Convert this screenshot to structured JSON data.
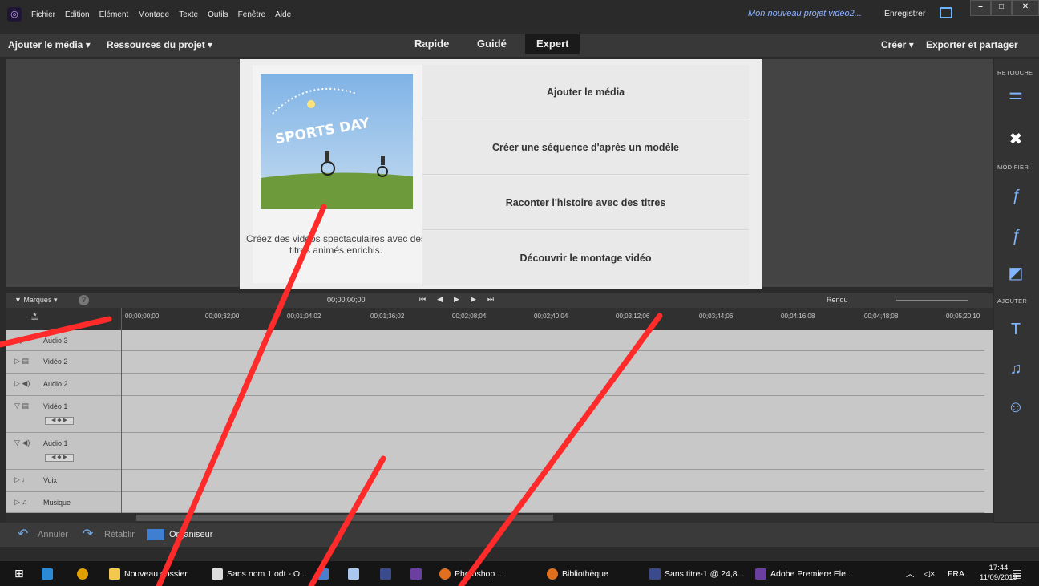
{
  "menu": [
    "Fichier",
    "Edition",
    "Elément",
    "Montage",
    "Texte",
    "Outils",
    "Fenêtre",
    "Aide"
  ],
  "titlebar": {
    "project": "Mon nouveau projet vidéo2...",
    "save": "Enregistrer"
  },
  "modebar": {
    "add_media": "Ajouter le média",
    "resources": "Ressources du projet",
    "tabs": [
      "Rapide",
      "Guidé",
      "Expert"
    ],
    "create": "Créer",
    "export": "Exporter et partager"
  },
  "panel": {
    "thumb_text": "SPORTS DAY",
    "description": "Créez des vidéos spectaculaires avec des titres animés enrichis.",
    "options": [
      "Ajouter le média",
      "Créer une séquence d'après un modèle",
      "Raconter l'histoire avec des titres",
      "Découvrir le montage vidéo"
    ]
  },
  "rightbar": {
    "retouche": "RETOUCHE",
    "modifier": "MODIFIER",
    "ajouter": "AJOUTER"
  },
  "timeline": {
    "markers": "Marques",
    "timecode": "00;00;00;00",
    "render": "Rendu",
    "ruler": [
      "00;00;00;00",
      "00;00;32;00",
      "00;01;04;02",
      "00;01;36;02",
      "00;02;08;04",
      "00;02;40;04",
      "00;03;12;06",
      "00;03;44;06",
      "00;04;16;08",
      "00;04;48;08",
      "00;05;20;10"
    ],
    "tracks": [
      {
        "name": "Audio 3",
        "icon": "speaker-icon"
      },
      {
        "name": "Vidéo 2",
        "icon": "film-icon"
      },
      {
        "name": "Audio 2",
        "icon": "speaker-icon"
      },
      {
        "name": "Vidéo 1",
        "icon": "film-icon"
      },
      {
        "name": "Audio 1",
        "icon": "speaker-icon"
      },
      {
        "name": "Voix",
        "icon": "microphone-icon"
      },
      {
        "name": "Musique",
        "icon": "music-icon"
      }
    ]
  },
  "bottombar": {
    "undo": "Annuler",
    "redo": "Rétablir",
    "organizer": "Organiseur"
  },
  "taskbar": {
    "items": [
      "Nouveau dossier",
      "Sans nom 1.odt - O...",
      "Sans titre-1 @ 24,8...",
      "Adobe Premiere Ele...",
      "Bibliothèque",
      "Photoshop ..."
    ],
    "lang": "FRA",
    "time": "17:44",
    "date": "11/09/2019",
    "notif": "3"
  }
}
